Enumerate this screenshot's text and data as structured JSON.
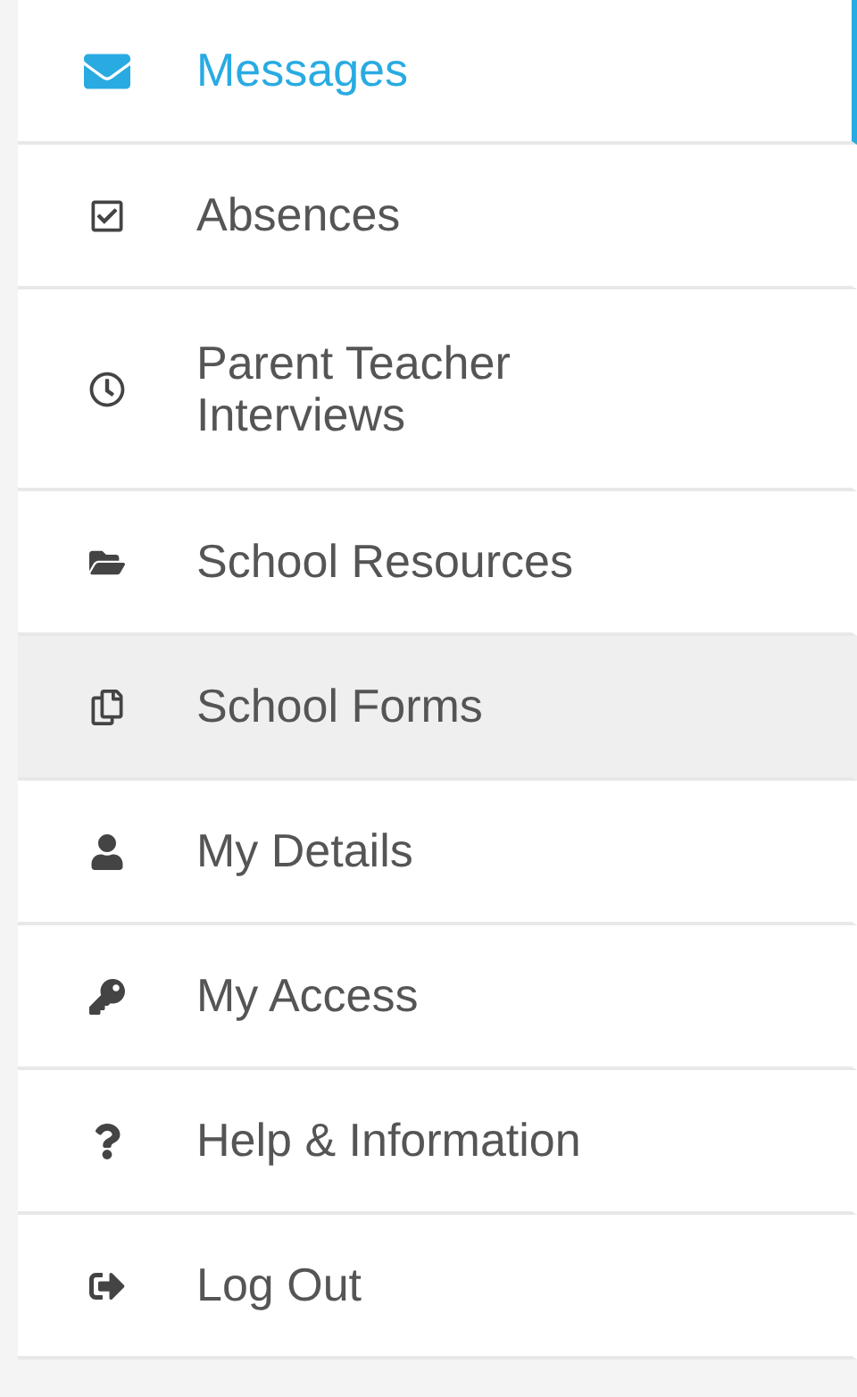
{
  "menu": {
    "items": [
      {
        "label": "Messages",
        "selected": true,
        "highlighted": false
      },
      {
        "label": "Absences",
        "selected": false,
        "highlighted": false
      },
      {
        "label": "Parent Teacher Interviews",
        "selected": false,
        "highlighted": false
      },
      {
        "label": "School Resources",
        "selected": false,
        "highlighted": false
      },
      {
        "label": "School Forms",
        "selected": false,
        "highlighted": true
      },
      {
        "label": "My Details",
        "selected": false,
        "highlighted": false
      },
      {
        "label": "My Access",
        "selected": false,
        "highlighted": false
      },
      {
        "label": "Help & Information",
        "selected": false,
        "highlighted": false
      },
      {
        "label": "Log Out",
        "selected": false,
        "highlighted": false
      }
    ]
  }
}
